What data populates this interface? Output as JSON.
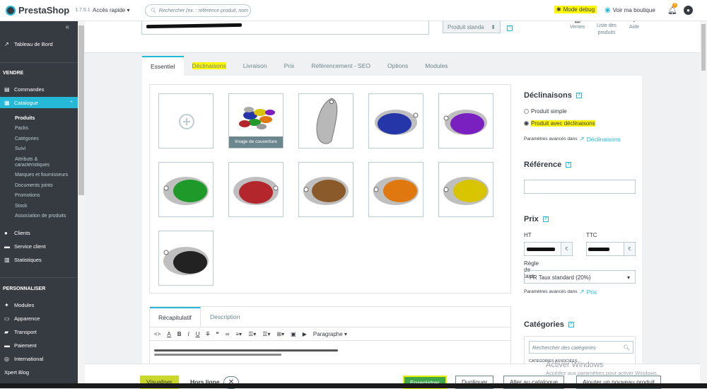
{
  "topbar": {
    "brand": "PrestaShop",
    "version": "1.7.5.1",
    "quick_access": "Accès rapide ▾",
    "search_placeholder": "Rechercher (ex. : référence produit, nom",
    "debug": "Mode debug",
    "visit": "Voir ma boutique",
    "notif_count": "2"
  },
  "sidebar": {
    "collapse": "«",
    "dashboard": "Tableau de Bord",
    "sell_heading": "VENDRE",
    "orders": "Commandes",
    "catalog": "Catalogue",
    "catalog_sub": [
      "Produits",
      "Packs",
      "Catégories",
      "Suivi",
      "Attributs &",
      "caractéristiques",
      "Marques et fournisseurs",
      "Documents joints",
      "Promotions",
      "Stock",
      "Association de produits"
    ],
    "clients": "Clients",
    "service": "Service client",
    "stats": "Statistiques",
    "custom_heading": "PERSONNALISER",
    "modules": "Modules",
    "appearance": "Apparence",
    "transport": "Transport",
    "payment": "Paiement",
    "international": "International",
    "blog": "Xpert Blog"
  },
  "header": {
    "product_type": "Produit standa",
    "actions": [
      {
        "label": "Ventes"
      },
      {
        "label": "Liste des\nproduits"
      },
      {
        "label": "Aide"
      }
    ]
  },
  "tabs": [
    "Essentiel",
    "Déclinaisons",
    "Livraison",
    "Prix",
    "Référencement - SEO",
    "Options",
    "Modules"
  ],
  "gallery": {
    "cover_label": "Image de couverture",
    "image_colors": [
      "#2536a8",
      "#7a20c0",
      "#1f9a2a",
      "#b3262c",
      "#8a5a2a",
      "#e07810",
      "#d8c400",
      "#222222"
    ]
  },
  "recap": {
    "tabs": [
      "Récapitulatif",
      "Description"
    ],
    "paragraph": "Paragraphe ▾"
  },
  "right": {
    "declinaisons_title": "Déclinaisons",
    "simple": "Produit simple",
    "with_variants": "Produit avec déclinaisons",
    "advanced": "Paramètres avancés dans",
    "advanced_link": "Déclinaisons",
    "reference_title": "Référence",
    "price_title": "Prix",
    "ht": "HT",
    "ttc": "TTC",
    "currency": "€",
    "tax_label": "Règle de taxe",
    "tax_value": "FR Taux standard (20%)",
    "price_link": "Prix",
    "categories_title": "Catégories",
    "cat_search": "Rechercher des catégories",
    "cat_assoc": "CATÉGORIES ASSOCIÉES"
  },
  "footer": {
    "preview": "Visualiser",
    "offline": "Hors ligne",
    "save": "Enregistrer",
    "duplicate": "Dupliquer",
    "catalog": "Aller au catalogue",
    "new": "Ajouter un nouveau produit"
  },
  "watermark": {
    "line1": "Activer Windows",
    "line2": "Accédez aux paramètres pour activer Windows."
  }
}
